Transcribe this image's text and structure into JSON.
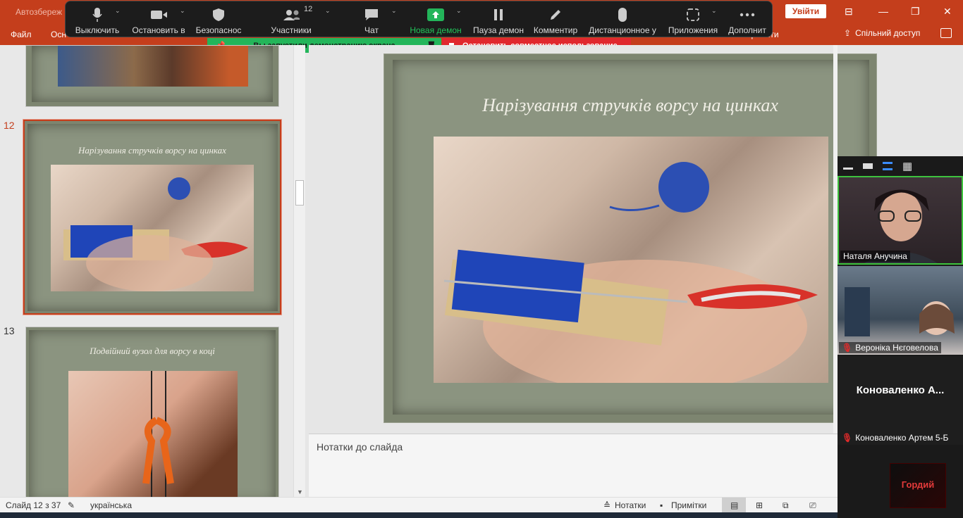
{
  "titlebar": {
    "autosave": "Автозбереж",
    "login": "Увійти"
  },
  "ribbon": {
    "file": "Файл",
    "partial": "Осн",
    "tell_me": "зробити",
    "share": "Спільний доступ"
  },
  "zoom": {
    "mute": "Выключить",
    "stop_video": "Остановить в",
    "security": "Безопаснос",
    "participants": "Участники",
    "participants_count": "12",
    "chat": "Чат",
    "new_share": "Новая демон",
    "pause_share": "Пауза демон",
    "annotate": "Комментир",
    "remote_control": "Дистанционное у",
    "apps": "Приложения",
    "more": "Дополнит"
  },
  "share_banner": {
    "status": "Вы запустили демонстрацию экрана",
    "stop": "Остановить совместное использование"
  },
  "thumbnails": {
    "slide12_num": "12",
    "slide12_title": "Нарізування  стручків  ворсу  на цинках",
    "slide13_num": "13",
    "slide13_title": "Подвійний вузол  для ворсу в коці"
  },
  "main_slide": {
    "title": "Нарізування  стручків  ворсу  на цинках"
  },
  "notes": {
    "placeholder": "Нотатки до слайда"
  },
  "status": {
    "slide": "Слайд 12 з 37",
    "language": "українська",
    "notes": "Нотатки",
    "comments": "Примітки"
  },
  "gallery": {
    "p1": "Наталя Анучина",
    "p2": "Вероніка Нєговелова",
    "p3_big": "Коноваленко А...",
    "p3": "Коноваленко Артем 5-Б",
    "p4_logo": "Гордий"
  },
  "colors": {
    "accent": "#c43e1c",
    "zoom_green": "#23b55a",
    "zoom_red": "#e0282e",
    "slide_bg": "#7d8570"
  }
}
